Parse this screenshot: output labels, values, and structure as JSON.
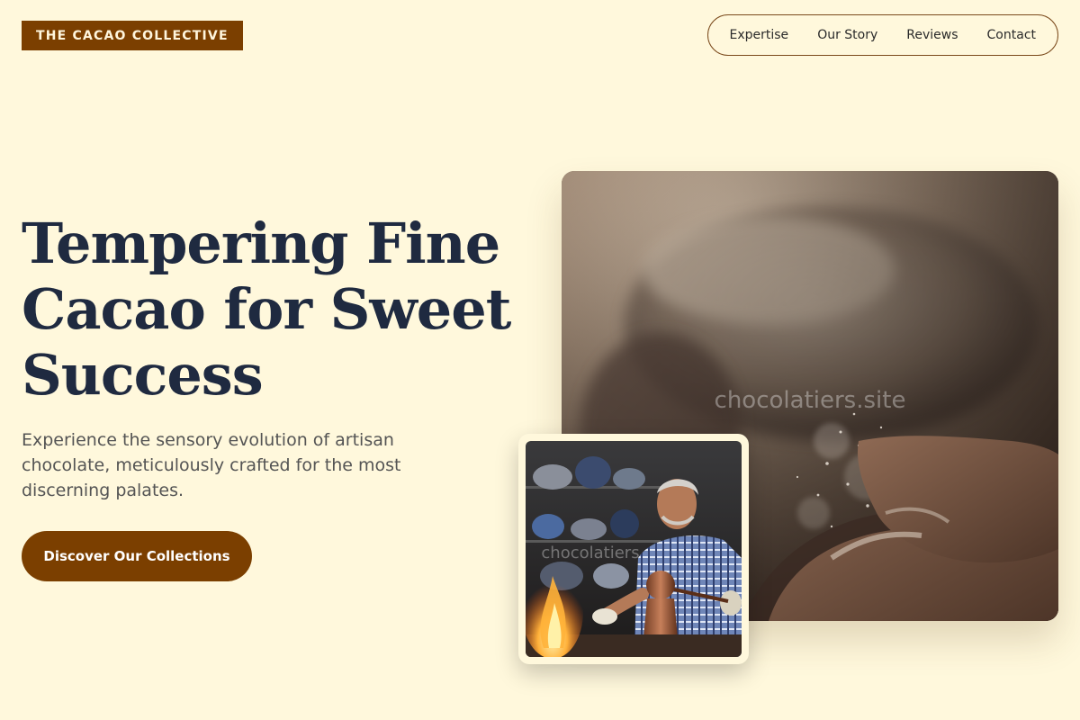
{
  "brand": {
    "logo_text": "THE CACAO COLLECTIVE"
  },
  "nav": {
    "items": [
      {
        "label": "Expertise"
      },
      {
        "label": "Our Story"
      },
      {
        "label": "Reviews"
      },
      {
        "label": "Contact"
      }
    ]
  },
  "hero": {
    "title_lines": [
      "Tempering Fine",
      "Cacao for Sweet",
      "Success"
    ],
    "subtitle": "Experience the sensory evolution of artisan chocolate, meticulously crafted for the most discerning palates.",
    "cta_label": "Discover Our Collections"
  },
  "images": {
    "main_watermark": "chocolatiers.site",
    "inset_watermark": "chocolatiers"
  },
  "colors": {
    "background": "#fff8dc",
    "brand_brown": "#7b3f00",
    "heading": "#1f2a40",
    "body_text": "#545454"
  }
}
